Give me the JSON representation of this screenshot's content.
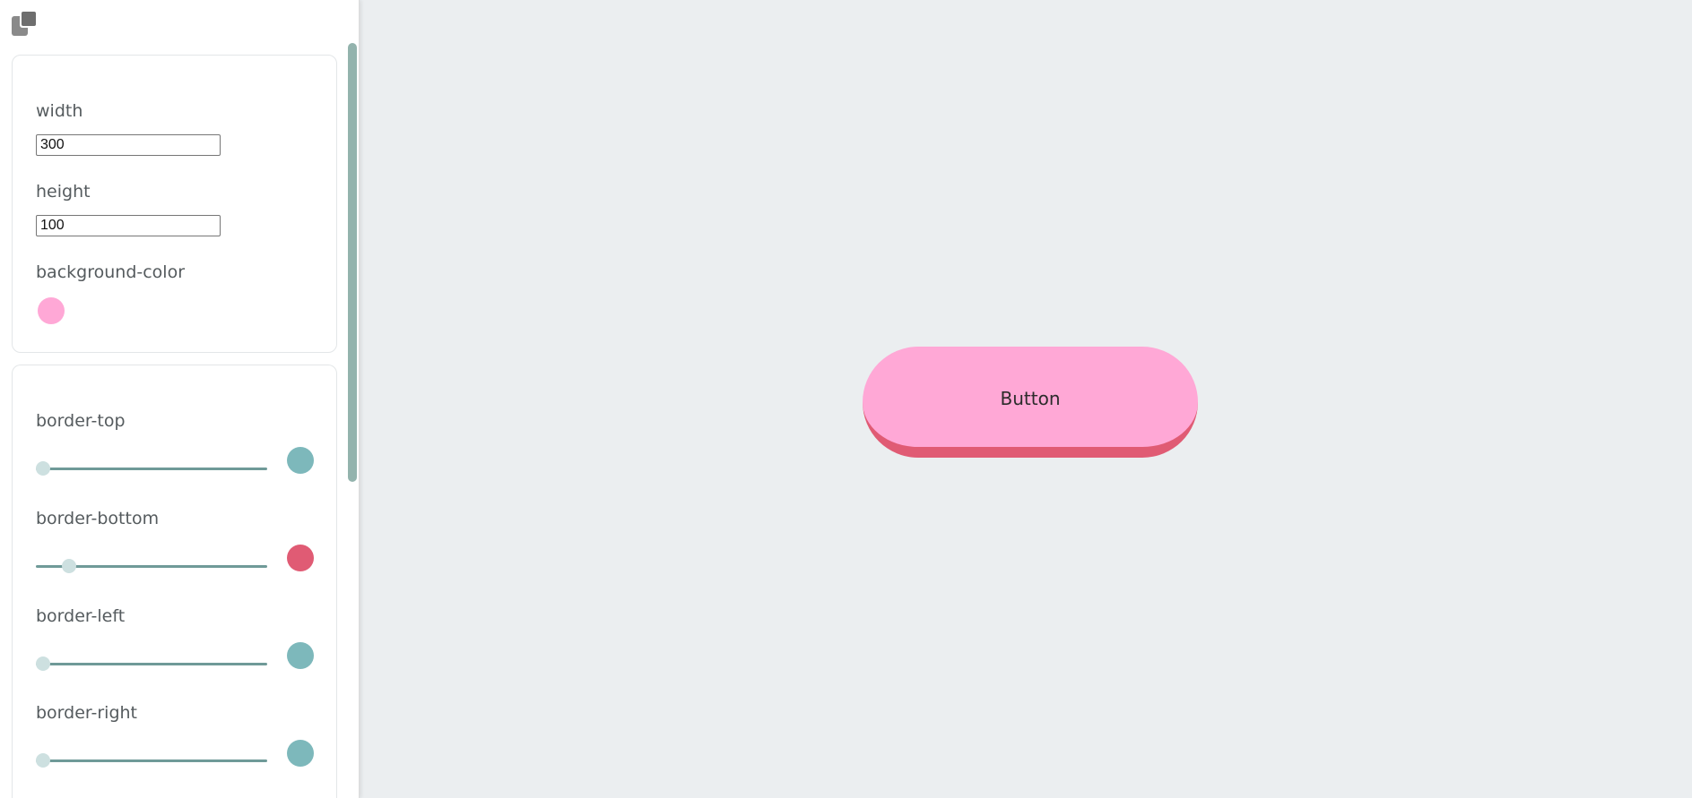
{
  "colors": {
    "button_bg": "#ffa8d6",
    "border_bottom": "#e05b74",
    "teal": "#7db8bb",
    "slider_track": "#6f9a98",
    "canvas_bg": "#ebeef0"
  },
  "toolbar": {
    "copy_icon": "copy-icon"
  },
  "size_panel": {
    "width_label": "width",
    "width_value": "300",
    "height_label": "height",
    "height_value": "100",
    "bg_label": "background-color",
    "bg_color": "#ffa8d6"
  },
  "border_panel": {
    "items": [
      {
        "label": "border-top",
        "value": 0,
        "color": "#7db8bb"
      },
      {
        "label": "border-bottom",
        "value": 12,
        "color": "#e05b74"
      },
      {
        "label": "border-left",
        "value": 0,
        "color": "#7db8bb"
      },
      {
        "label": "border-right",
        "value": 0,
        "color": "#7db8bb"
      }
    ]
  },
  "preview": {
    "button_label": "Button"
  }
}
